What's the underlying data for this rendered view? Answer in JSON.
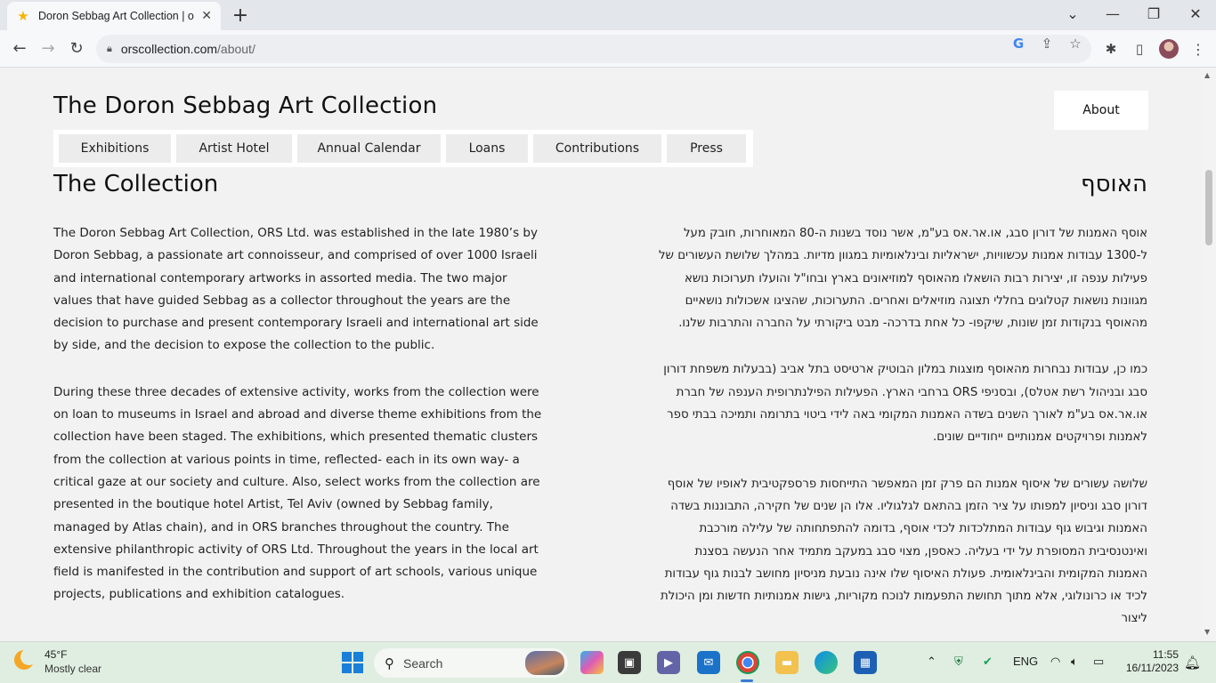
{
  "browser": {
    "tab_title": "Doron Sebbag Art Collection | o",
    "tab_close": "✕",
    "new_tab": "+",
    "url_host": "orscollection.com",
    "url_path": "/about/"
  },
  "site": {
    "title": "The Doron Sebbag Art Collection",
    "about": "About",
    "menu": [
      "Exhibitions",
      "Artist Hotel",
      "Annual Calendar",
      "Loans",
      "Contributions",
      "Press"
    ]
  },
  "content": {
    "heading_en": "The Collection",
    "heading_he": "האוסף",
    "en_paragraphs": [
      "The Doron Sebbag Art Collection, ORS Ltd. was established in the late 1980’s by Doron Sebbag, a passionate art connoisseur, and comprised of over 1000 Israeli and international contemporary artworks in assorted media. The two major values that have guided Sebbag as a collector throughout the years are the decision to purchase and present contemporary Israeli and international art side by side, and the decision to expose the collection to the public.",
      "During these three decades of extensive activity, works from the collection were on loan to museums in Israel and abroad and diverse theme exhibitions from the collection have been staged. The exhibitions, which presented thematic clusters from the collection at various points in time, reflected- each in its own way- a critical gaze at our society and culture. Also, select works from the collection are presented in the boutique hotel Artist, Tel Aviv (owned by Sebbag family, managed by Atlas chain), and in ORS branches throughout the country. The extensive philanthropic activity of ORS Ltd. Throughout the years in the local art field is manifested in the contribution and support of art schools, various unique projects, publications and exhibition catalogues."
    ],
    "he_paragraphs": [
      "אוסף האמנות של דורון סבג, או.אר.אס בע\"מ, אשר נוסד בשנות ה-80 המאוחרות, חובק מעל ל-1300 עבודות אמנות עכשוויות, ישראליות ובינלאומיות במגוון מדיות. במהלך שלושת העשורים של פעילות ענפה זו, יצירות רבות הושאלו מהאוסף למוזיאונים בארץ ובחו\"ל והועלו תערוכות נושא מגוונות נושאות קטלוגים בחללי תצוגה מוזיאלים ואחרים. התערוכות, שהציגו אשכולות נושאיים מהאוסף בנקודות זמן שונות, שיקפו- כל אחת בדרכה- מבט ביקורתי על החברה והתרבות שלנו.",
      "כמו כן, עבודות נבחרות מהאוסף מוצגות במלון הבוטיק ארטיסט בתל אביב (בבעלות משפחת דורון סבג ובניהול רשת אטלס), ובסניפי ORS ברחבי הארץ. הפעילות הפילנתרופית הענפה של חברת או.אר.אס בע\"מ לאורך השנים בשדה האמנות המקומי באה לידי ביטוי בתרומה ותמיכה בבתי ספר לאמנות ופרויקטים אמנותיים ייחודיים שונים.",
      "שלושה עשורים של איסוף אמנות הם פרק זמן המאפשר התייחסות פרספקטיבית לאופיו של אוסף דורון סבג וניסיון למפותו על ציר הזמן בהתאם לגלגוליו. אלו הן שנים של חקירה, התבוננות בשדה האמנות וגיבוש גוף עבודות המתלכדות לכדי אוסף, בדומה להתפתחותה של עלילה מורכבת ואינטנסיבית המסופרת על ידי בעליה. כאספן, מצוי סבג במעקב מתמיד אחר הנעשה בסצנת האמנות המקומית והבינלאומית. פעולת האיסוף שלו אינה נובעת מניסיון מחושב לבנות גוף עבודות לכיד או כרונולוגי, אלא מתוך תחושת התפעמות לנוכח מקוריות, גישות אמנותיות חדשות ומן היכולת ליצור"
    ]
  },
  "taskbar": {
    "temperature": "45°F",
    "condition": "Mostly clear",
    "search_label": "Search",
    "language": "ENG",
    "time": "11:55",
    "date": "16/11/2023"
  }
}
